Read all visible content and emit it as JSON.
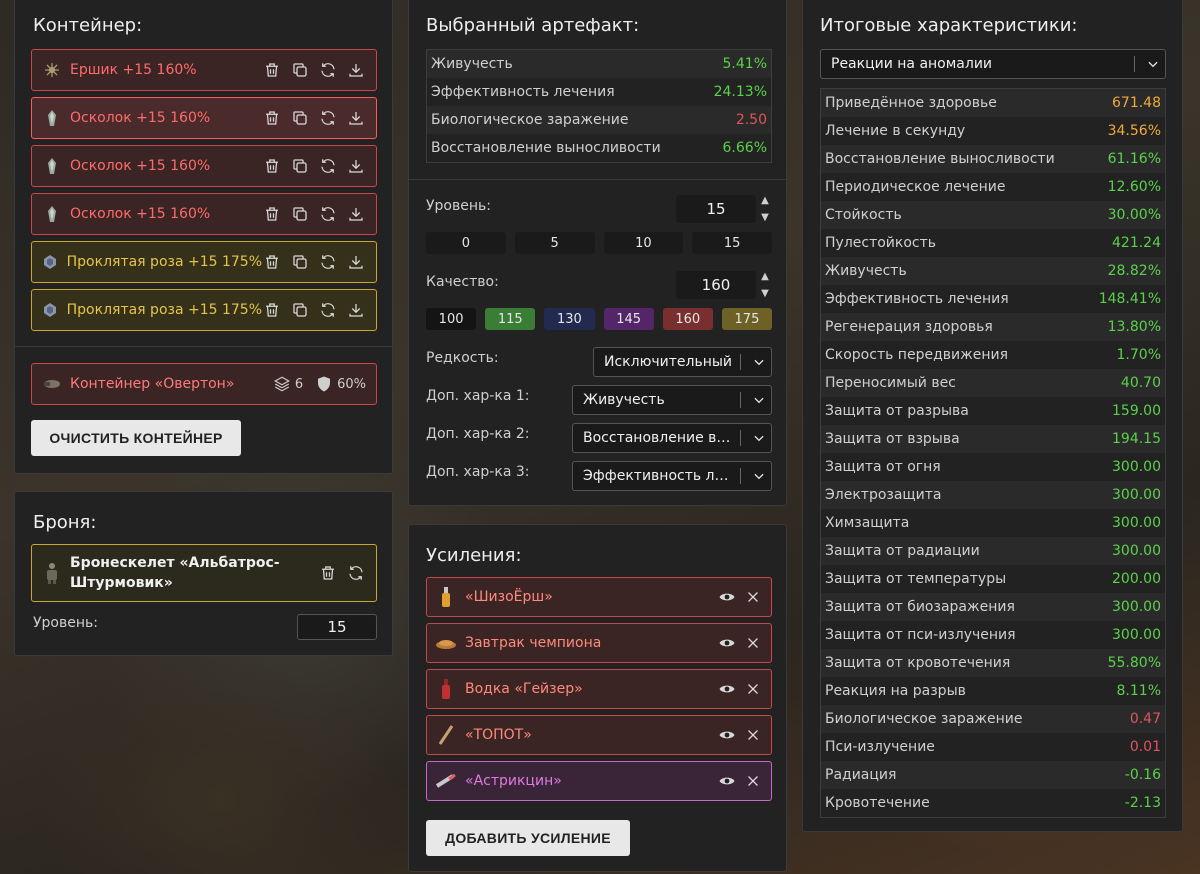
{
  "container": {
    "title": "Контейнер:",
    "items": [
      {
        "label": "Ершик +15 160%",
        "icon": "artifact-icon",
        "color": "red"
      },
      {
        "label": "Осколок +15 160%",
        "icon": "artifact-icon",
        "color": "red",
        "selected": true
      },
      {
        "label": "Осколок +15 160%",
        "icon": "artifact-icon",
        "color": "red"
      },
      {
        "label": "Осколок +15 160%",
        "icon": "artifact-icon",
        "color": "red"
      },
      {
        "label": "Проклятая роза +15 175%",
        "icon": "artifact-icon",
        "color": "gold"
      },
      {
        "label": "Проклятая роза +15 175%",
        "icon": "artifact-icon",
        "color": "gold"
      }
    ],
    "holder": {
      "label": "Контейнер «Овертон»",
      "slots": "6",
      "protection": "60%"
    },
    "clear_label": "ОЧИСТИТЬ КОНТЕЙНЕР"
  },
  "armor": {
    "title": "Броня:",
    "name": "Бронескелет «Альбатрос-Штурмовик»",
    "level_label": "Уровень:",
    "level_value": "15"
  },
  "artifact": {
    "title": "Выбранный артефакт:",
    "stats": [
      {
        "name": "Живучесть",
        "value": "5.41%",
        "tone": "green"
      },
      {
        "name": "Эффективность лечения",
        "value": "24.13%",
        "tone": "green"
      },
      {
        "name": "Биологическое заражение",
        "value": "2.50",
        "tone": "red"
      },
      {
        "name": "Восстановление выносливости",
        "value": "6.66%",
        "tone": "green"
      }
    ],
    "level_label": "Уровень:",
    "level_value": "15",
    "level_presets": [
      "0",
      "5",
      "10",
      "15"
    ],
    "quality_label": "Качество:",
    "quality_value": "160",
    "quality_presets": [
      "100",
      "115",
      "130",
      "145",
      "160",
      "175"
    ],
    "rarity_label": "Редкость:",
    "rarity_value": "Исключительный",
    "extra1_label": "Доп. хар-ка 1:",
    "extra1_value": "Живучесть",
    "extra2_label": "Доп. хар-ка 2:",
    "extra2_value": "Восстановление выносливости",
    "extra3_label": "Доп. хар-ка 3:",
    "extra3_value": "Эффективность лечения"
  },
  "boosts": {
    "title": "Усиления:",
    "items": [
      {
        "label": "«ШизоЁрш»",
        "color": "red"
      },
      {
        "label": "Завтрак чемпиона",
        "color": "red"
      },
      {
        "label": "Водка «Гейзер»",
        "color": "red"
      },
      {
        "label": "«ТОПОТ»",
        "color": "red"
      },
      {
        "label": "«Астрикцин»",
        "color": "pink"
      }
    ],
    "add_label": "ДОБАВИТЬ УСИЛЕНИЕ"
  },
  "totals": {
    "title": "Итоговые характеристики:",
    "filter_value": "Реакции на аномалии",
    "stats": [
      {
        "name": "Приведённое здоровье",
        "value": "671.48",
        "tone": "orange"
      },
      {
        "name": "Лечение в секунду",
        "value": "34.56%",
        "tone": "orange"
      },
      {
        "name": "Восстановление выносливости",
        "value": "61.16%",
        "tone": "green"
      },
      {
        "name": "Периодическое лечение",
        "value": "12.60%",
        "tone": "green"
      },
      {
        "name": "Стойкость",
        "value": "30.00%",
        "tone": "green"
      },
      {
        "name": "Пулестойкость",
        "value": "421.24",
        "tone": "green"
      },
      {
        "name": "Живучесть",
        "value": "28.82%",
        "tone": "green"
      },
      {
        "name": "Эффективность лечения",
        "value": "148.41%",
        "tone": "green"
      },
      {
        "name": "Регенерация здоровья",
        "value": "13.80%",
        "tone": "green"
      },
      {
        "name": "Скорость передвижения",
        "value": "1.70%",
        "tone": "green"
      },
      {
        "name": "Переносимый вес",
        "value": "40.70",
        "tone": "green"
      },
      {
        "name": "Защита от разрыва",
        "value": "159.00",
        "tone": "green"
      },
      {
        "name": "Защита от взрыва",
        "value": "194.15",
        "tone": "green"
      },
      {
        "name": "Защита от огня",
        "value": "300.00",
        "tone": "green"
      },
      {
        "name": "Электрозащита",
        "value": "300.00",
        "tone": "green"
      },
      {
        "name": "Химзащита",
        "value": "300.00",
        "tone": "green"
      },
      {
        "name": "Защита от радиации",
        "value": "300.00",
        "tone": "green"
      },
      {
        "name": "Защита от температуры",
        "value": "200.00",
        "tone": "green"
      },
      {
        "name": "Защита от биозаражения",
        "value": "300.00",
        "tone": "green"
      },
      {
        "name": "Защита от пси-излучения",
        "value": "300.00",
        "tone": "green"
      },
      {
        "name": "Защита от кровотечения",
        "value": "55.80%",
        "tone": "green"
      },
      {
        "name": "Реакция на разрыв",
        "value": "8.11%",
        "tone": "green"
      },
      {
        "name": "Биологическое заражение",
        "value": "0.47",
        "tone": "red"
      },
      {
        "name": "Пси-излучение",
        "value": "0.01",
        "tone": "red"
      },
      {
        "name": "Радиация",
        "value": "-0.16",
        "tone": "green"
      },
      {
        "name": "Кровотечение",
        "value": "-2.13",
        "tone": "green"
      }
    ]
  },
  "colors": {
    "green": "#5bd14b",
    "red": "#e0545a",
    "orange": "#f0a93a",
    "panel": "#222222"
  }
}
